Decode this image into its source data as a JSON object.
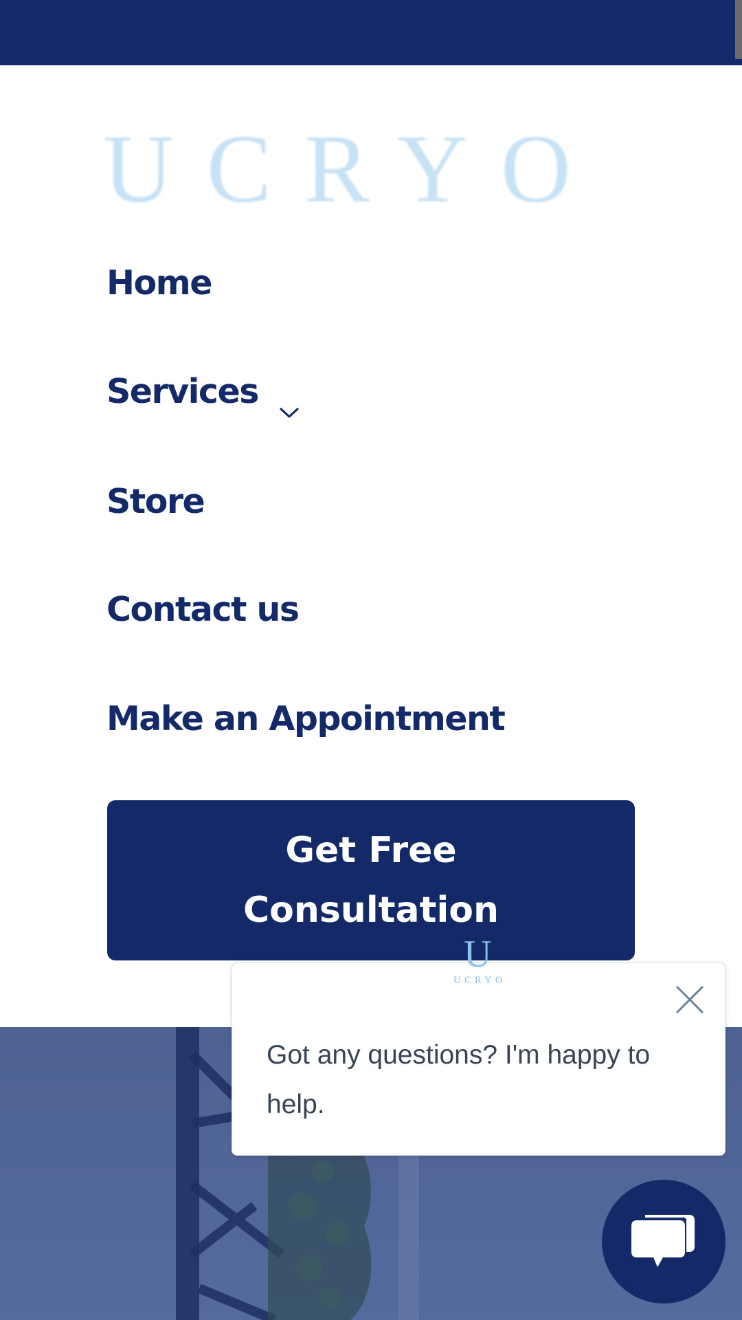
{
  "brand": {
    "logo_text": "UCRYO"
  },
  "nav": {
    "items": [
      {
        "label": "Home"
      },
      {
        "label": "Services"
      },
      {
        "label": "Store"
      },
      {
        "label": "Contact us"
      },
      {
        "label": "Make an Appointment"
      }
    ]
  },
  "cta": {
    "label_line1": "Get Free",
    "label_line2": "Consultation"
  },
  "chat": {
    "avatar_letter": "U",
    "avatar_text": "UCRYO",
    "message": "Got any questions? I'm happy to help."
  },
  "colors": {
    "brand_navy": "#132968",
    "logo_light_blue": "#c6e1f5",
    "hero_overlay": "#4e6294"
  },
  "icons": {
    "services_dropdown": "chevron-down-icon",
    "chat_close": "close-icon",
    "chat_launcher": "chat-bubble-icon"
  }
}
